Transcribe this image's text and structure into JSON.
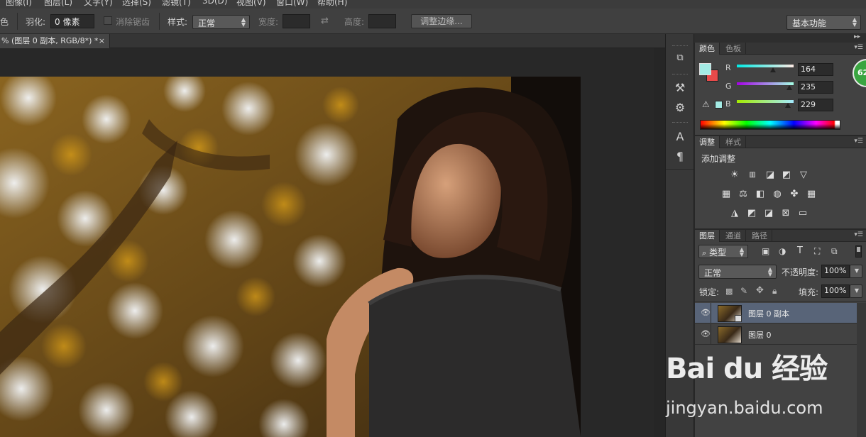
{
  "menubar": {
    "items": [
      "图像(I)",
      "图层(L)",
      "文字(Y)",
      "选择(S)",
      "滤镜(T)",
      "3D(D)",
      "视图(V)",
      "窗口(W)",
      "帮助(H)"
    ]
  },
  "options": {
    "mode_glyph": "色",
    "feather_label": "羽化:",
    "feather_value": "0 像素",
    "antialias_label": "消除锯齿",
    "style_label": "样式:",
    "style_value": "正常",
    "width_label": "宽度:",
    "height_label": "高度:",
    "refine_edge_label": "调整边缘...",
    "workspace_value": "基本功能"
  },
  "document": {
    "tab_title": "% (图层 0 副本, RGB/8*) *",
    "close_glyph": "×"
  },
  "color_panel": {
    "tabs": [
      "颜色",
      "色板"
    ],
    "channels": [
      {
        "label": "R",
        "value": "164",
        "fraction": 0.643
      },
      {
        "label": "G",
        "value": "235",
        "fraction": 0.922
      },
      {
        "label": "B",
        "value": "229",
        "fraction": 0.898
      }
    ],
    "foreground": "#a4ebe5",
    "background": "#e84a4a",
    "warning_glyph": "⚠"
  },
  "adjustments_panel": {
    "tabs": [
      "调整",
      "样式"
    ],
    "title": "添加调整"
  },
  "layers_panel": {
    "tabs": [
      "图层",
      "通道",
      "路径"
    ],
    "filter_kind": "类型",
    "blend_mode": "正常",
    "opacity_label": "不透明度:",
    "opacity_value": "100%",
    "lock_label": "锁定:",
    "fill_label": "填充:",
    "fill_value": "100%",
    "layers": [
      {
        "name": "图层 0 副本",
        "selected": true
      },
      {
        "name": "图层 0",
        "selected": false
      }
    ]
  },
  "badge": {
    "value": "62"
  },
  "watermark": {
    "logo": "Bai du 经验",
    "url": "jingyan.baidu.com"
  },
  "colors": {
    "panel_bg": "#424242",
    "selection": "#586478",
    "accent_green": "#3aa541"
  }
}
